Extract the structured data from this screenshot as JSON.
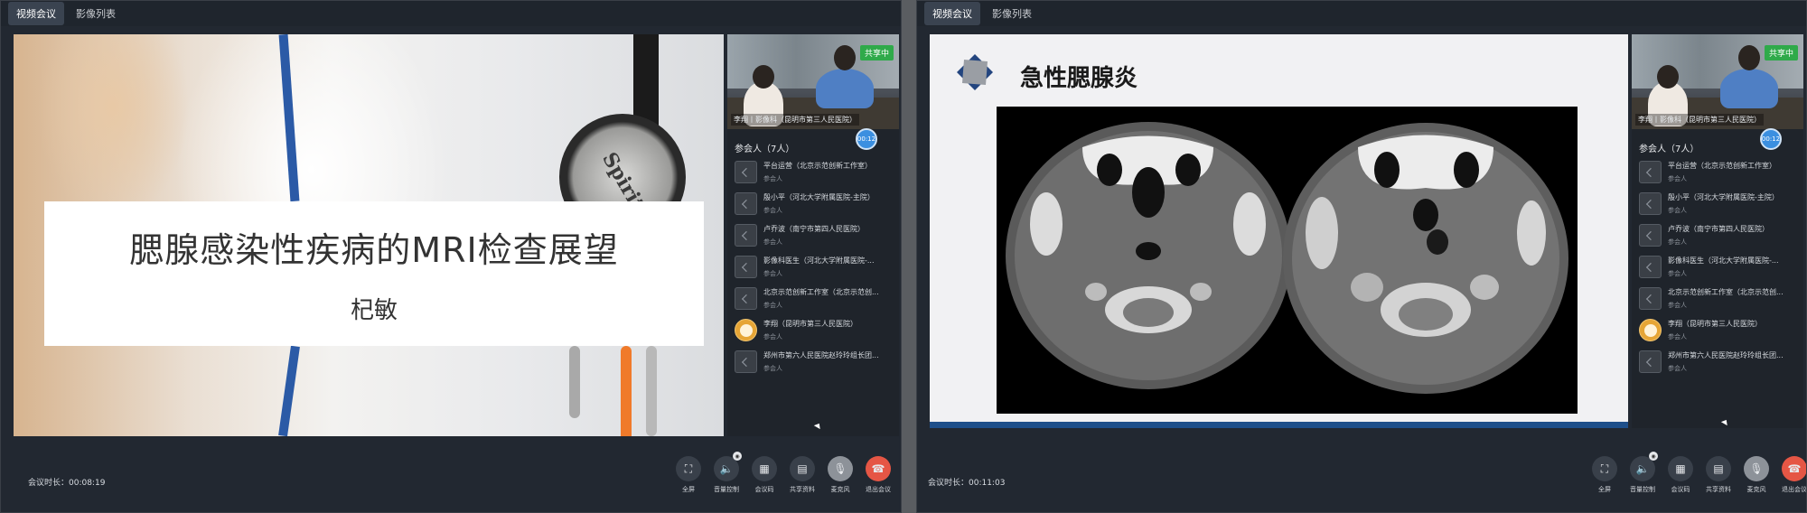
{
  "tabs": [
    "视频会议",
    "影像列表"
  ],
  "left": {
    "title_line1": "腮腺感染性疾病的MRI检查展望",
    "title_line2": "杞敏",
    "stethoscope_text": "Spirit",
    "video_label": "李翔丨影像科（昆明市第三人民医院）",
    "sharing_badge": "共享中",
    "timer_badge": "00:12",
    "participants_title": "参会人（7人）",
    "duration": "会议时长：00:08:19"
  },
  "right": {
    "slide_title": "急性腮腺炎",
    "video_label": "李翔丨影像科（昆明市第三人民医院）",
    "sharing_badge": "共享中",
    "timer_badge": "00:12",
    "participants_title": "参会人（7人）",
    "duration": "会议时长：00:11:03"
  },
  "participants": [
    {
      "name": "平台运营（北京示范创新工作室）",
      "role": "参会人",
      "avatar": "default"
    },
    {
      "name": "殷小平（河北大学附属医院-主院）",
      "role": "参会人",
      "avatar": "default"
    },
    {
      "name": "卢乔波（南宁市第四人民医院）",
      "role": "参会人",
      "avatar": "default"
    },
    {
      "name": "影像科医生（河北大学附属医院-...",
      "role": "参会人",
      "avatar": "default"
    },
    {
      "name": "北京示范创新工作室（北京示范创...",
      "role": "参会人",
      "avatar": "default"
    },
    {
      "name": "李翔（昆明市第三人民医院）",
      "role": "参会人",
      "avatar": "cartoon"
    },
    {
      "name": "郑州市第六人民医院赵玲玲组长团...",
      "role": "参会人",
      "avatar": "default"
    }
  ],
  "controls": [
    {
      "label": "全屏",
      "icon": "fullscreen-icon"
    },
    {
      "label": "音量控制",
      "icon": "volume-icon"
    },
    {
      "label": "会议码",
      "icon": "qrcode-icon"
    },
    {
      "label": "共享资料",
      "icon": "document-icon"
    },
    {
      "label": "麦克风",
      "icon": "microphone-icon"
    },
    {
      "label": "退出会议",
      "icon": "hangup-icon"
    }
  ],
  "colors": {
    "accent": "#3b8fe0",
    "end_call": "#e55645",
    "sharing": "#2faa4a",
    "slide_bar": "#1e4f8a"
  }
}
